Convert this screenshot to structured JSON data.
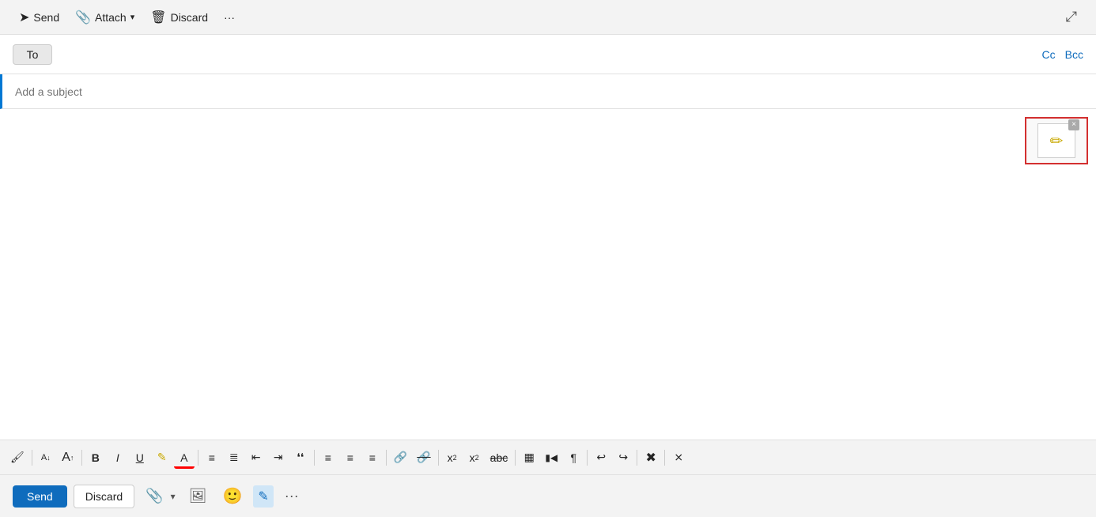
{
  "toolbar": {
    "send_label": "Send",
    "attach_label": "Attach",
    "discard_label": "Discard",
    "more_label": "···",
    "pop_out_icon": "⤢"
  },
  "to_row": {
    "to_label": "To",
    "cc_label": "Cc",
    "bcc_label": "Bcc",
    "to_placeholder": ""
  },
  "subject_row": {
    "placeholder": "Add a subject"
  },
  "body": {
    "placeholder": ""
  },
  "format_toolbar": {
    "buttons": [
      {
        "name": "format-painter",
        "label": "🖌",
        "title": "Format painter"
      },
      {
        "name": "font-size-decrease",
        "label": "A",
        "title": "Decrease font size",
        "sub": true
      },
      {
        "name": "font-size-increase",
        "label": "A",
        "title": "Increase font size",
        "sup": true
      },
      {
        "name": "bold",
        "label": "B",
        "title": "Bold"
      },
      {
        "name": "italic",
        "label": "I",
        "title": "Italic"
      },
      {
        "name": "underline",
        "label": "U",
        "title": "Underline"
      },
      {
        "name": "highlight",
        "label": "🖍",
        "title": "Highlight"
      },
      {
        "name": "font-color",
        "label": "A",
        "title": "Font color"
      },
      {
        "name": "align-left",
        "label": "≡",
        "title": "Align left"
      },
      {
        "name": "bullets",
        "label": "☰",
        "title": "Bullets"
      },
      {
        "name": "decrease-indent",
        "label": "⇤",
        "title": "Decrease indent"
      },
      {
        "name": "increase-indent",
        "label": "⇥",
        "title": "Increase indent"
      },
      {
        "name": "blockquote",
        "label": "❝",
        "title": "Blockquote"
      },
      {
        "name": "align-center",
        "label": "≡",
        "title": "Align center"
      },
      {
        "name": "justify",
        "label": "≡",
        "title": "Justify"
      },
      {
        "name": "align-right",
        "label": "≡",
        "title": "Align right"
      },
      {
        "name": "insert-link",
        "label": "🔗",
        "title": "Insert link"
      },
      {
        "name": "remove-link",
        "label": "🔗",
        "title": "Remove link"
      },
      {
        "name": "superscript",
        "label": "x²",
        "title": "Superscript"
      },
      {
        "name": "subscript",
        "label": "x₂",
        "title": "Subscript"
      },
      {
        "name": "strikethrough",
        "label": "S̶",
        "title": "Strikethrough"
      },
      {
        "name": "insert-image2",
        "label": "▣",
        "title": "Insert image"
      },
      {
        "name": "show-source",
        "label": "|◁",
        "title": "Show source"
      },
      {
        "name": "paragraph",
        "label": "¶",
        "title": "Paragraph"
      },
      {
        "name": "undo",
        "label": "↩",
        "title": "Undo"
      },
      {
        "name": "redo",
        "label": "↪",
        "title": "Redo"
      },
      {
        "name": "clear-format",
        "label": "✕",
        "title": "Clear formatting"
      },
      {
        "name": "insert-table",
        "label": "⊞",
        "title": "Insert table"
      }
    ]
  },
  "bottom_bar": {
    "send_label": "Send",
    "discard_label": "Discard",
    "more_label": "···"
  },
  "signature_widget": {
    "icon": "✏",
    "close": "×"
  }
}
